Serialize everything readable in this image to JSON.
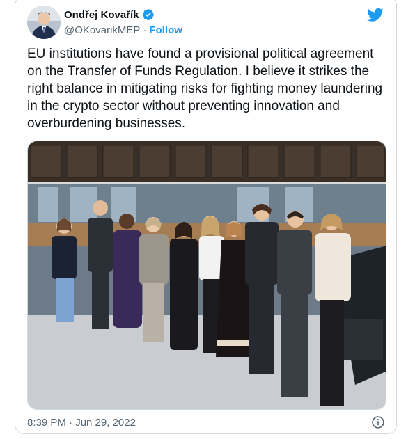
{
  "author": {
    "name": "Ondřej Kovařík",
    "handle": "@OKovarikMEP",
    "separator": "·",
    "follow_label": "Follow"
  },
  "tweet": {
    "text": "EU institutions have found a provisional political agreement on the Transfer of Funds Regulation. I believe it strikes the right balance in mitigating risks for fighting money laundering in the crypto sector without preventing innovation and overburdening businesses.",
    "timestamp": "8:39 PM · Jun 29, 2022"
  },
  "colors": {
    "accent": "#1d9bf0",
    "text": "#0f1419",
    "secondary": "#536471",
    "border": "#cfd9de"
  },
  "icons": [
    "verified-badge-icon",
    "twitter-bird-icon",
    "info-icon"
  ]
}
